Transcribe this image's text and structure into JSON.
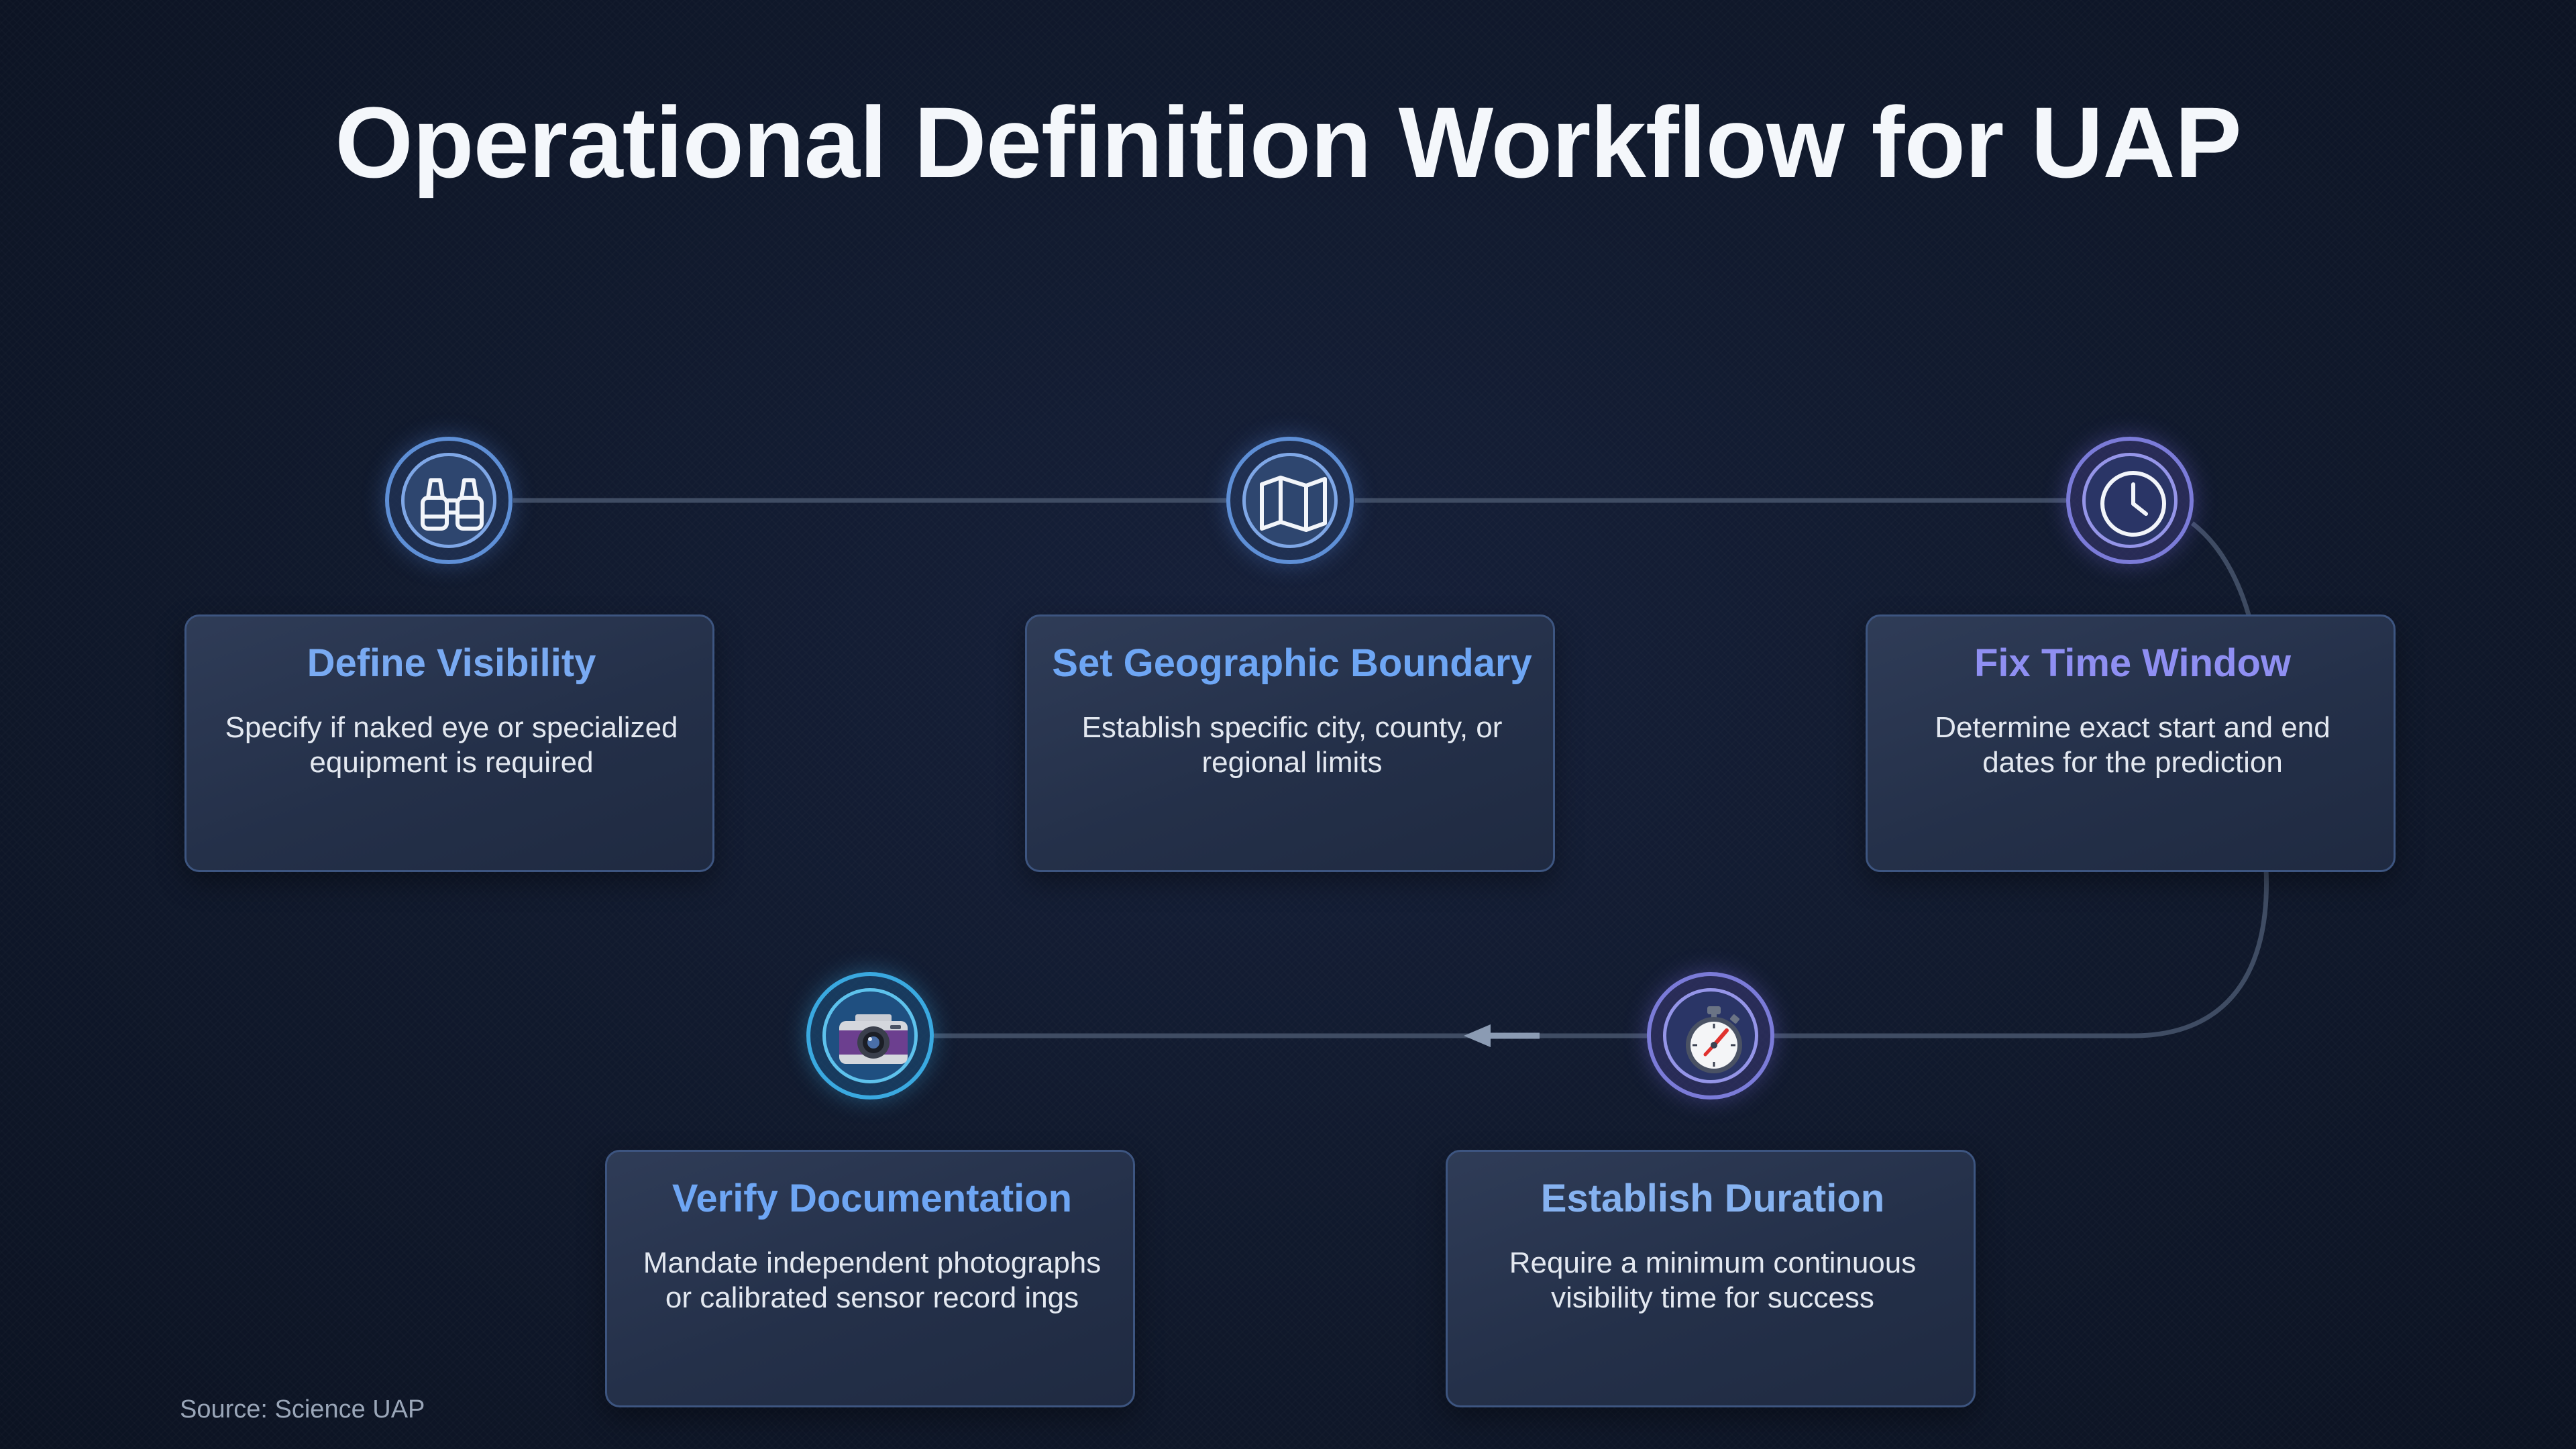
{
  "title": "Operational Definition Workflow for UAP",
  "source": "Source: Science UAP",
  "colors": {
    "background": "#111a2e",
    "title_blue": "#79aaf2",
    "title_purple": "#8f8ff2",
    "connector": "#3f4c63",
    "arrow": "#8b9bb3"
  },
  "steps": [
    {
      "title": "Define Visibility",
      "description": "Specify if naked eye or specialized equipment is required",
      "icon": "binoculars-icon"
    },
    {
      "title": "Set Geographic Boundary",
      "description": "Establish specific city, county, or regional limits",
      "icon": "map-icon"
    },
    {
      "title": "Fix Time Window",
      "description": "Determine exact start and end dates for the prediction",
      "icon": "clock-icon"
    },
    {
      "title": "Establish Duration",
      "description": "Require a minimum continuous visibility time for success",
      "icon": "stopwatch-icon"
    },
    {
      "title": "Verify Documentation",
      "description": "Mandate independent photographs or calibrated sensor record ings",
      "icon": "camera-icon"
    }
  ]
}
